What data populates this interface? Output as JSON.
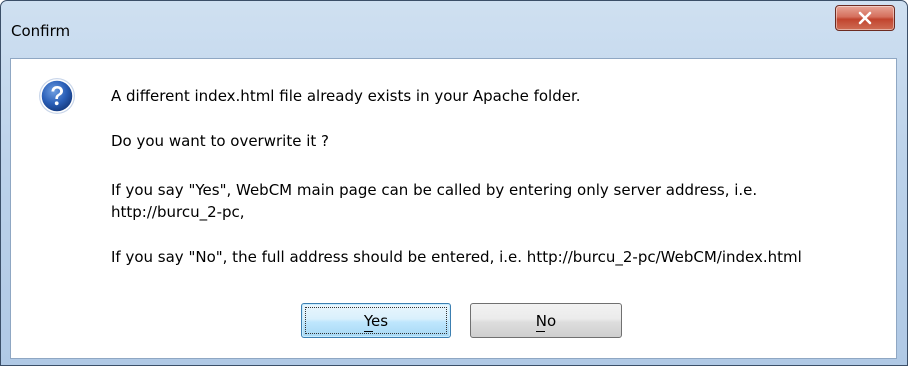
{
  "window": {
    "title": "Confirm"
  },
  "icons": {
    "close": "close-icon",
    "question": "question-icon"
  },
  "colors": {
    "close_button": "#c94a33",
    "question_icon": "#1f4f9e",
    "default_button_border": "#3c7fb1"
  },
  "message": {
    "line1": "A different index.html file already exists in your Apache folder.",
    "line2": "Do you want to overwrite it ?",
    "line3a": "If you say \"Yes\", WebCM main page can be called by entering only server address, i.e.",
    "line3b": "http://burcu_2-pc,",
    "line4": "If you say \"No\", the full address should be entered, i.e. http://burcu_2-pc/WebCM/index.html"
  },
  "buttons": {
    "yes_label": "Yes",
    "no_label": "No"
  }
}
